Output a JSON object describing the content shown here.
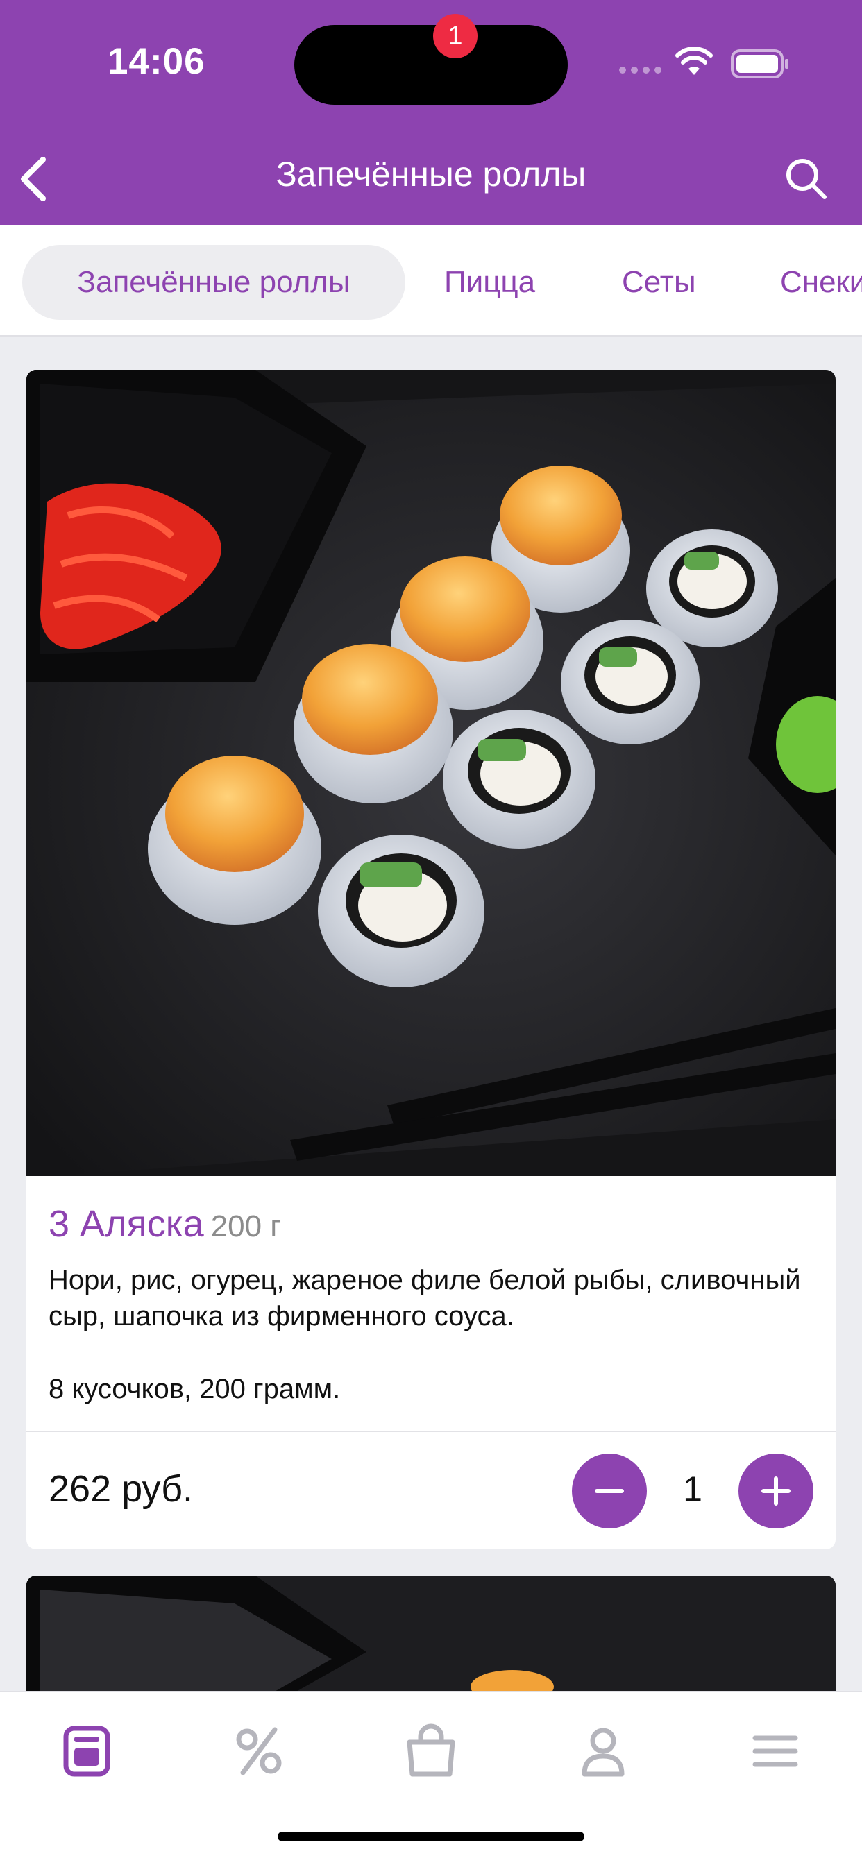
{
  "status_bar": {
    "time": "14:06"
  },
  "header": {
    "title": "Запечённые роллы"
  },
  "category_tabs": [
    {
      "label": "Запечённые роллы",
      "active": true
    },
    {
      "label": "Пицца",
      "active": false
    },
    {
      "label": "Сеты",
      "active": false
    },
    {
      "label": "Снеки",
      "active": false
    }
  ],
  "product": {
    "name": "3 Аляска",
    "weight": "200 г",
    "description": "Нори, рис, огурец, жареное филе белой рыбы, сливочный сыр, шапочка из фирменного соуса.",
    "pieces": "8 кусочков, 200 грамм.",
    "price": "262 руб.",
    "quantity": "1"
  },
  "tab_bar": {
    "items": [
      {
        "icon": "catalog-icon",
        "active": true
      },
      {
        "icon": "percent-icon",
        "active": false
      },
      {
        "icon": "cart-icon",
        "active": false
      },
      {
        "icon": "profile-icon",
        "active": false
      },
      {
        "icon": "menu-icon",
        "active": false
      }
    ],
    "cart_badge": "1"
  },
  "colors": {
    "brand": "#8d43b0",
    "badge": "#ee2b43",
    "inactive_icon": "#b5b5bc"
  }
}
